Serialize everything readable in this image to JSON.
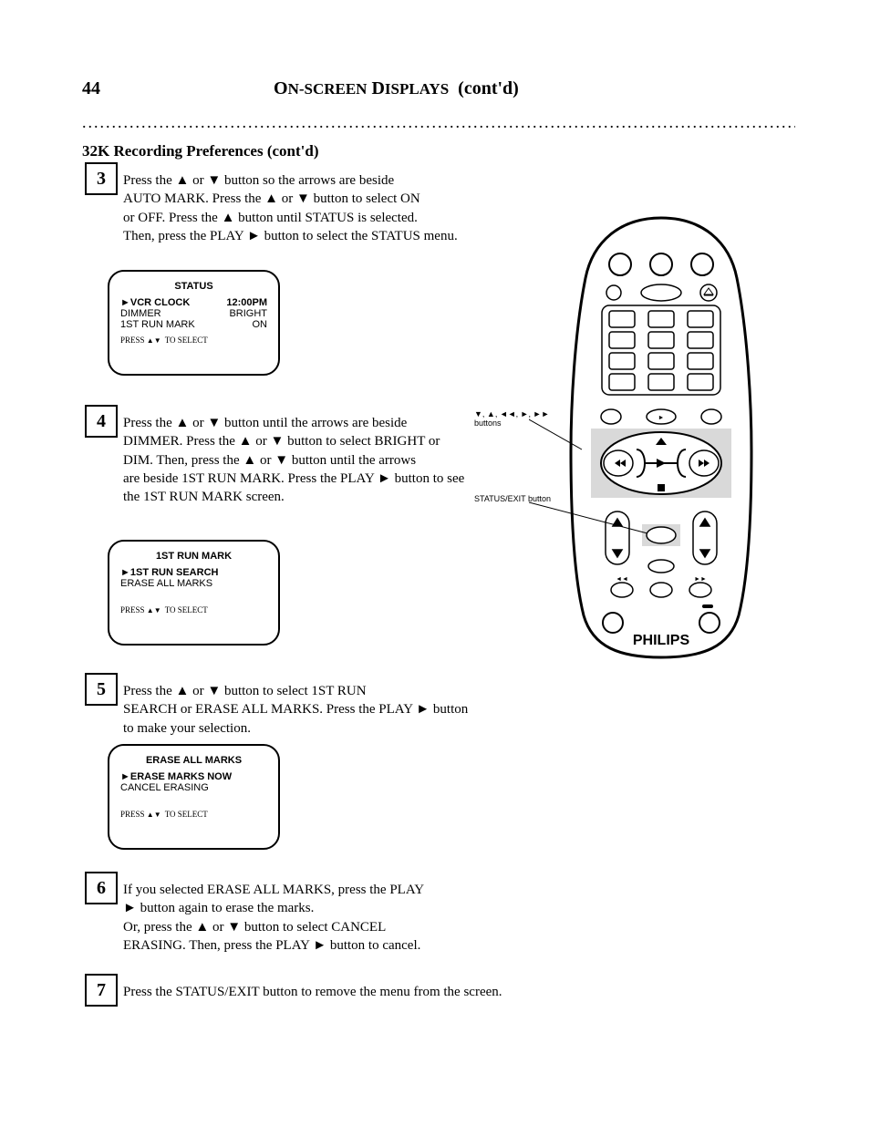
{
  "header": {
    "page_number": "44",
    "title_prefix": "O",
    "title_rest": "N-SCREEN",
    "title_suffix_prefix": " D",
    "title_suffix_rest": "ISPLAYS",
    "title_cont": "(cont'd)",
    "subtitle": "32K Recording Preferences (cont'd)"
  },
  "step3": {
    "num": "3",
    "boxed_text": "",
    "t0": "Press the ",
    "up": "▲",
    "t1": " or ",
    "down": "▼",
    "t2": " button so the arrows are beside",
    "line2a": "AUTO MARK. Press the ",
    "line2b": " or ",
    "line2c": " button to select ON",
    "line3a": "or OFF. Press the ",
    "line3b": " button until STATUS is selected.",
    "line4": "Then, press the PLAY ",
    "play": "►",
    "line4b": " button to select the STATUS menu."
  },
  "card1": {
    "title": "STATUS",
    "rows": [
      {
        "l": "►VCR CLOCK",
        "r": "12:00PM",
        "bold": true
      },
      {
        "l": "  DIMMER",
        "r": "BRIGHT"
      },
      {
        "l": "  1ST RUN MARK",
        "r": "ON"
      }
    ],
    "hint_prefix": "PRESS ",
    "hint_tri": "▲▼",
    "hint_suffix": " TO SELECT"
  },
  "step4": {
    "num": "4",
    "t0": "Press the ",
    "t1": " or ",
    "t2": " button until the arrows are beside",
    "line2a": "DIMMER. Press the ",
    "line2b": " or ",
    "line2c": " button to select BRIGHT or",
    "line3a": "DIM. Then, press the ",
    "line3b": " or ",
    "line3c": " button until the arrows",
    "line4a": "are beside 1ST RUN MARK. Press the PLAY ",
    "play": "►",
    "line4b": " button to see",
    "line5": "the 1ST RUN MARK screen."
  },
  "card2": {
    "title": "1ST RUN MARK",
    "rows": [
      {
        "l": "►1ST RUN SEARCH",
        "r": "",
        "bold": true
      },
      {
        "l": "  ERASE ALL MARKS",
        "r": ""
      }
    ],
    "hint_prefix": "PRESS ",
    "hint_tri": "▲▼",
    "hint_suffix": " TO SELECT"
  },
  "step5": {
    "num": "5",
    "t0": "Press the ",
    "t1": " or ",
    "t2": " button to select 1ST RUN",
    "line2a": "SEARCH or ERASE ALL MARKS. Press the PLAY ",
    "play": "►",
    "line2b": " button",
    "line3": "to make your selection."
  },
  "card3": {
    "title": "ERASE ALL MARKS",
    "rows": [
      {
        "l": "►ERASE MARKS NOW",
        "r": "",
        "bold": true
      },
      {
        "l": "  CANCEL ERASING",
        "r": ""
      }
    ],
    "hint_prefix": "PRESS ",
    "hint_tri": "▲▼",
    "hint_suffix": " TO SELECT"
  },
  "step6": {
    "num": "6",
    "t0": "If you selected ERASE ALL MARKS, press the PLAY",
    "play": "►",
    "line2": " button again to erase the marks.",
    "line3a": "Or, press the ",
    "line3b": " or ",
    "line3c": " button to select CANCEL",
    "line4a": "ERASING. Then, press the PLAY ",
    "line4b": " button to cancel."
  },
  "step7": {
    "num": "7",
    "text": "Press the STATUS/EXIT button to remove the menu from the screen."
  },
  "remote": {
    "brand": "PHILIPS",
    "callout_top": "▼, ▲, ◄◄, ►, ►► buttons",
    "callout_bottom": "STATUS/EXIT button"
  }
}
